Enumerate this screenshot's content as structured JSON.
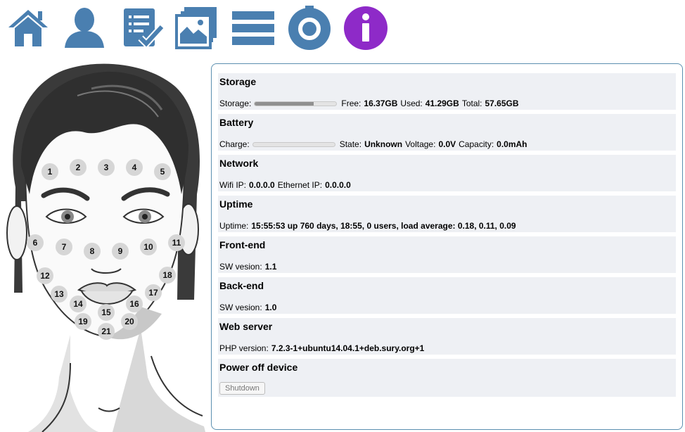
{
  "toolbar": {
    "accent_color": "#4a7fb0",
    "info_color": "#8e2ac8",
    "icons": [
      "home-icon",
      "user-icon",
      "checklist-icon",
      "gallery-icon",
      "menu-icon",
      "settings-icon",
      "info-icon"
    ]
  },
  "face_zones": [
    "1",
    "2",
    "3",
    "4",
    "5",
    "6",
    "7",
    "8",
    "9",
    "10",
    "11",
    "12",
    "13",
    "14",
    "15",
    "16",
    "17",
    "18",
    "19",
    "20",
    "21"
  ],
  "sections": {
    "storage": {
      "title": "Storage",
      "label": "Storage:",
      "used_fraction": 0.72,
      "free_label": "Free:",
      "free_value": "16.37GB",
      "used_label": "Used:",
      "used_value": "41.29GB",
      "total_label": "Total:",
      "total_value": "57.65GB"
    },
    "battery": {
      "title": "Battery",
      "label": "Charge:",
      "charge_fraction": 0,
      "state_label": "State:",
      "state_value": "Unknown",
      "voltage_label": "Voltage:",
      "voltage_value": "0.0V",
      "capacity_label": "Capacity:",
      "capacity_value": "0.0mAh"
    },
    "network": {
      "title": "Network",
      "wifi_label": "Wifi IP:",
      "wifi_value": "0.0.0.0",
      "eth_label": "Ethernet IP:",
      "eth_value": "0.0.0.0"
    },
    "uptime": {
      "title": "Uptime",
      "label": "Uptime:",
      "value": "15:55:53 up 760 days, 18:55, 0 users, load average: 0.18, 0.11, 0.09"
    },
    "frontend": {
      "title": "Front-end",
      "label": "SW vesion:",
      "value": "1.1"
    },
    "backend": {
      "title": "Back-end",
      "label": "SW vesion:",
      "value": "1.0"
    },
    "webserver": {
      "title": "Web server",
      "label": "PHP version:",
      "value": "7.2.3-1+ubuntu14.04.1+deb.sury.org+1"
    },
    "power": {
      "title": "Power off device",
      "button_label": "Shutdown"
    }
  }
}
